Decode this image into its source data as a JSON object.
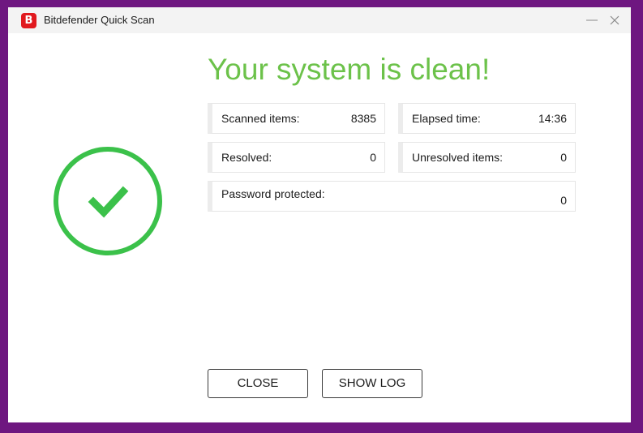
{
  "window": {
    "title": "Bitdefender Quick Scan",
    "logo_letter": "B",
    "brand_color": "#e1191e",
    "minimize_icon": "minimize-icon",
    "close_icon": "close-icon"
  },
  "status": {
    "icon": "checkmark-circle-icon",
    "color": "#3bc14a",
    "headline": "Your system is clean!",
    "headline_color": "#6cc24a"
  },
  "stats": {
    "scanned": {
      "label": "Scanned items:",
      "value": "8385"
    },
    "elapsed": {
      "label": "Elapsed time:",
      "value": "14:36"
    },
    "resolved": {
      "label": "Resolved:",
      "value": "0"
    },
    "unresolved": {
      "label": "Unresolved items:",
      "value": "0"
    },
    "password": {
      "label": "Password protected:",
      "value": "0"
    }
  },
  "buttons": {
    "close": "CLOSE",
    "show_log": "SHOW LOG"
  }
}
